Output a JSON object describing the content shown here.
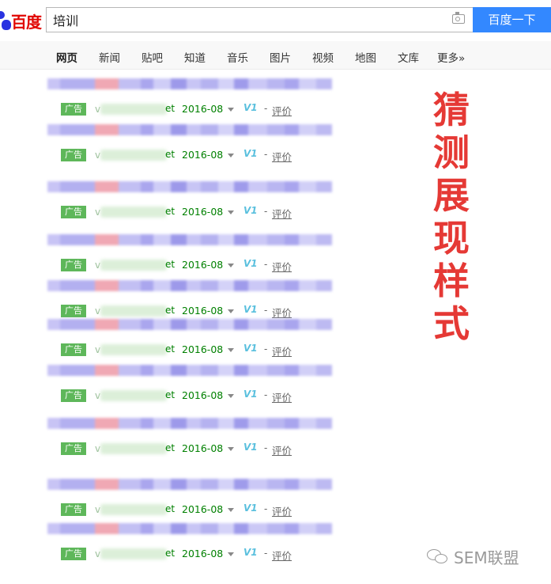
{
  "header": {
    "logo_text": "百度",
    "search_value": "培训",
    "search_button": "百度一下"
  },
  "nav": [
    {
      "label": "网页",
      "active": true
    },
    {
      "label": "新闻"
    },
    {
      "label": "贴吧"
    },
    {
      "label": "知道"
    },
    {
      "label": "音乐"
    },
    {
      "label": "图片"
    },
    {
      "label": "视频"
    },
    {
      "label": "地图"
    },
    {
      "label": "文库"
    },
    {
      "label": "更多»"
    }
  ],
  "results": [
    {
      "ad_label": "广告",
      "url_start": "v",
      "url_end": "et",
      "date": "2016-08",
      "v_badge": "V1",
      "dash": "-",
      "eval": "评价"
    },
    {
      "ad_label": "广告",
      "url_start": "v",
      "url_end": "et",
      "date": "2016-08",
      "v_badge": "V1",
      "dash": "-",
      "eval": "评价"
    },
    {
      "ad_label": "广告",
      "url_start": "v",
      "url_end": "et",
      "date": "2016-08",
      "v_badge": "V1",
      "dash": "-",
      "eval": "评价"
    },
    {
      "ad_label": "广告",
      "url_start": "v",
      "url_end": "et",
      "date": "2016-08",
      "v_badge": "V1",
      "dash": "-",
      "eval": "评价"
    },
    {
      "ad_label": "广告",
      "url_start": "v",
      "url_end": "et",
      "date": "2016-08",
      "v_badge": "V1",
      "dash": "-",
      "eval": "评价"
    },
    {
      "ad_label": "广告",
      "url_start": "v",
      "url_end": "et",
      "date": "2016-08",
      "v_badge": "V1",
      "dash": "-",
      "eval": "评价"
    },
    {
      "ad_label": "广告",
      "url_start": "v",
      "url_end": "et",
      "date": "2016-08",
      "v_badge": "V1",
      "dash": "-",
      "eval": "评价"
    },
    {
      "ad_label": "广告",
      "url_start": "v",
      "url_end": "et",
      "date": "2016-08",
      "v_badge": "V1",
      "dash": "-",
      "eval": "评价"
    },
    {
      "ad_label": "广告",
      "url_start": "v",
      "url_end": "et",
      "date": "2016-08",
      "v_badge": "V1",
      "dash": "-",
      "eval": "评价"
    },
    {
      "ad_label": "广告",
      "url_start": "v",
      "url_end": "et",
      "date": "2016-08",
      "v_badge": "V1",
      "dash": "-",
      "eval": "评价"
    }
  ],
  "overlay_chars": [
    "猜",
    "测",
    "展",
    "现",
    "样",
    "式"
  ],
  "watermark": "SEM联盟",
  "colors": {
    "search_button": "#3388ff",
    "ad_badge": "#5eb75a",
    "url_green": "#008000",
    "overlay_red": "#e53935",
    "blur_blue": "#b3b0f0",
    "blur_pink": "#f0a8b4"
  }
}
